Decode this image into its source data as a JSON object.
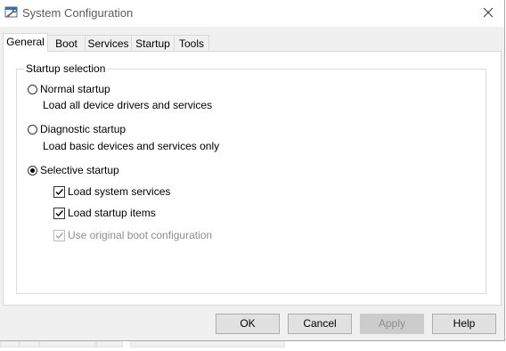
{
  "window": {
    "title": "System Configuration",
    "icon": "msconfig-app-icon",
    "close_icon": "close-icon"
  },
  "tabs": [
    {
      "label": "General",
      "active": true
    },
    {
      "label": "Boot",
      "active": false
    },
    {
      "label": "Services",
      "active": false
    },
    {
      "label": "Startup",
      "active": false
    },
    {
      "label": "Tools",
      "active": false
    }
  ],
  "startup_selection": {
    "legend": "Startup selection",
    "normal": {
      "label": "Normal startup",
      "description": "Load all device drivers and services",
      "selected": false
    },
    "diagnostic": {
      "label": "Diagnostic startup",
      "description": "Load basic devices and services only",
      "selected": false
    },
    "selective": {
      "label": "Selective startup",
      "selected": true,
      "options": [
        {
          "label": "Load system services",
          "checked": true,
          "enabled": true
        },
        {
          "label": "Load startup items",
          "checked": true,
          "enabled": true
        },
        {
          "label": "Use original boot configuration",
          "checked": true,
          "enabled": false
        }
      ]
    }
  },
  "buttons": {
    "ok": "OK",
    "cancel": "Cancel",
    "apply": "Apply",
    "help": "Help"
  }
}
